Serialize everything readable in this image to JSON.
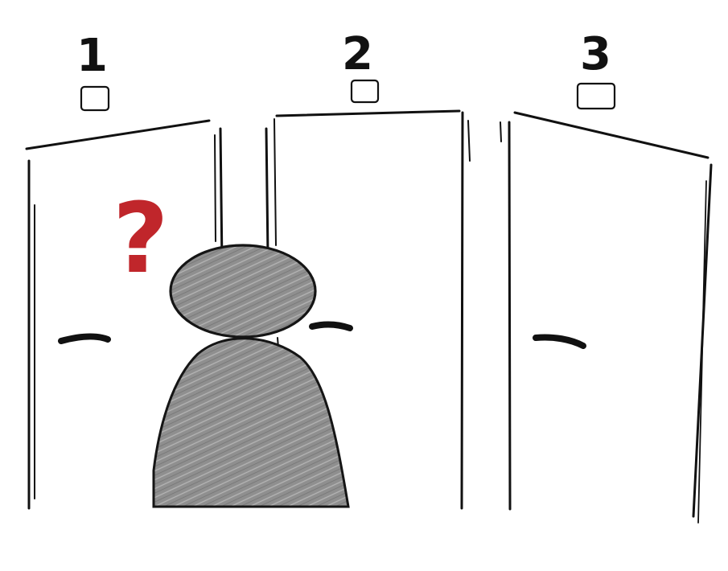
{
  "scene": {
    "doors": [
      {
        "number": "1"
      },
      {
        "number": "2"
      },
      {
        "number": "3"
      }
    ],
    "person": {
      "thought": "?"
    },
    "colors": {
      "ink": "#111111",
      "figure_fill": "#8f8f8f",
      "figure_stroke": "#151515",
      "question_mark": "#c0262b",
      "background": "#ffffff"
    },
    "icons": {
      "door_sign": "blank-sign-icon",
      "door_handle": "door-handle-icon",
      "thought": "question-mark-icon"
    }
  }
}
